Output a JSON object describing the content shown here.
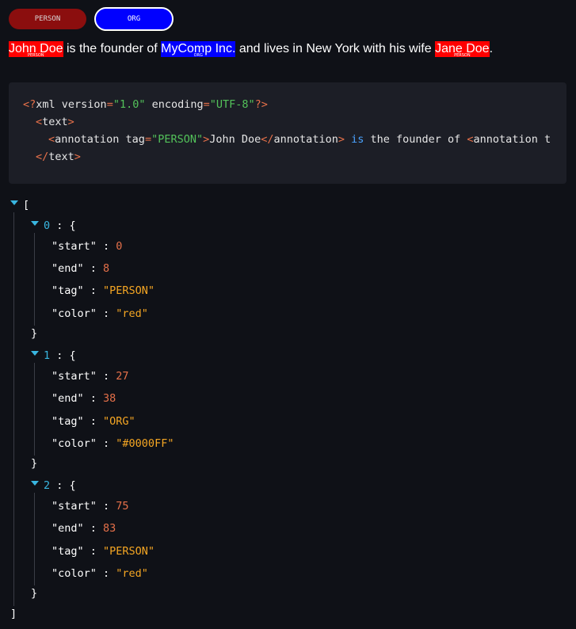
{
  "tags": {
    "person_label": "PERSON",
    "org_label": "ORG",
    "person_color": "#8b0e0e",
    "org_color": "#0000ff"
  },
  "sentence": {
    "e1_text": "John Doe",
    "e1_tag": "PERSON",
    "t1": " is the founder of ",
    "e2_text": "MyComp Inc.",
    "e2_tag": "ORG",
    "t2": " and lives in New York with his wife ",
    "e3_text": "Jane Doe",
    "e3_tag": "PERSON",
    "t3": "."
  },
  "code": {
    "line1": {
      "open": "<?",
      "name": "xml",
      "a1": " version",
      "eq": "=",
      "v1": "\"1.0\"",
      "a2": " encoding",
      "v2": "\"UTF-8\"",
      "close": "?>"
    },
    "line2": {
      "open": "<",
      "name": "text",
      "close": ">"
    },
    "line3": {
      "open": "<",
      "name": "annotation",
      "attr": " tag",
      "eq": "=",
      "val": "\"PERSON\"",
      "close": ">",
      "content": "John Doe",
      "end_open": "</",
      "end_name": "annotation",
      "end_close": ">",
      "kw": " is",
      "rest": " the founder of ",
      "next_open": "<",
      "next_name": "annotation t"
    },
    "line4": {
      "open": "</",
      "name": "text",
      "close": ">"
    }
  },
  "json_tree": {
    "open": "[",
    "close": "]",
    "items": [
      {
        "index": "0",
        "start": "0",
        "end": "8",
        "tag": "\"PERSON\"",
        "color": "\"red\""
      },
      {
        "index": "1",
        "start": "27",
        "end": "38",
        "tag": "\"ORG\"",
        "color": "\"#0000FF\""
      },
      {
        "index": "2",
        "start": "75",
        "end": "83",
        "tag": "\"PERSON\"",
        "color": "\"red\""
      }
    ],
    "keys": {
      "start": "\"start\"",
      "end": "\"end\"",
      "tag": "\"tag\"",
      "color": "\"color\""
    },
    "colon": " : ",
    "brace_open": "{",
    "brace_close": "}"
  }
}
